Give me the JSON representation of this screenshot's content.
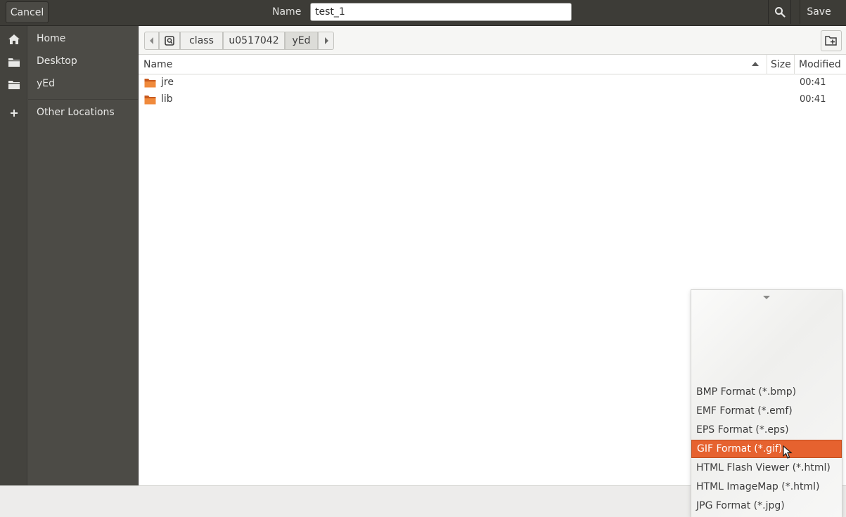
{
  "header": {
    "cancel_label": "Cancel",
    "name_label": "Name",
    "name_value": "test_1",
    "save_label": "Save"
  },
  "sidebar": {
    "items": [
      {
        "label": "Home",
        "icon": "home-icon"
      },
      {
        "label": "Desktop",
        "icon": "folder-icon"
      },
      {
        "label": "yEd",
        "icon": "folder-icon"
      },
      {
        "label": "Other Locations",
        "icon": "plus-icon"
      }
    ]
  },
  "pathbar": {
    "crumbs": [
      "class",
      "u0517042",
      "yEd"
    ]
  },
  "filelist": {
    "columns": {
      "name": "Name",
      "size": "Size",
      "modified": "Modified"
    },
    "rows": [
      {
        "name": "jre",
        "size": "",
        "modified": "00:41"
      },
      {
        "name": "lib",
        "size": "",
        "modified": "00:41"
      }
    ]
  },
  "filetype_menu": {
    "options": [
      "BMP Format (*.bmp)",
      "EMF Format (*.emf)",
      "EPS Format (*.eps)",
      "GIF Format (*.gif)",
      "HTML Flash Viewer (*.html)",
      "HTML ImageMap (*.html)",
      "JPG Format (*.jpg)"
    ],
    "selected": "GIF Format (*.gif)"
  },
  "colors": {
    "accent": "#e6622f",
    "headerbar": "#3d3c37",
    "sidebar": "#4c4b46"
  }
}
